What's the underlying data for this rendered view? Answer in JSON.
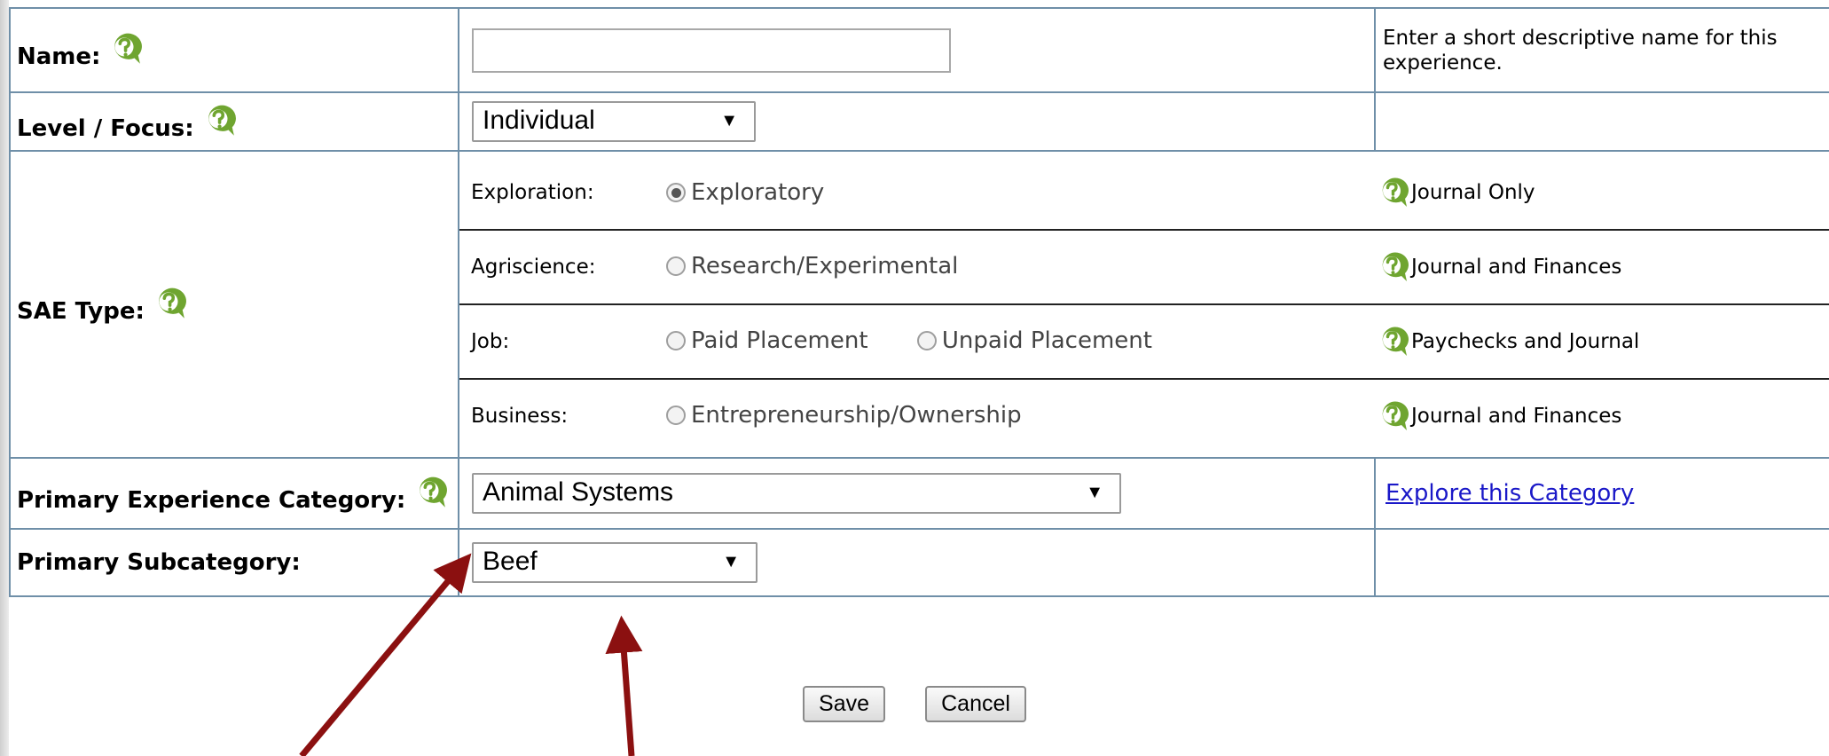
{
  "form": {
    "name_label": "Name:",
    "name_value": "",
    "name_hint": "Enter a short descriptive name for this experience.",
    "level_label": "Level / Focus:",
    "level_value": "Individual",
    "sae_label": "SAE Type:",
    "sae_rows": [
      {
        "category": "Exploration:",
        "options": [
          {
            "label": "Exploratory",
            "selected": true
          }
        ],
        "tracking": "Journal Only"
      },
      {
        "category": "Agriscience:",
        "options": [
          {
            "label": "Research/Experimental",
            "selected": false
          }
        ],
        "tracking": "Journal and Finances"
      },
      {
        "category": "Job:",
        "options": [
          {
            "label": "Paid Placement",
            "selected": false
          },
          {
            "label": "Unpaid Placement",
            "selected": false
          }
        ],
        "tracking": "Paychecks and Journal"
      },
      {
        "category": "Business:",
        "options": [
          {
            "label": "Entrepreneurship/Ownership",
            "selected": false
          }
        ],
        "tracking": "Journal and Finances"
      }
    ],
    "primary_category_label": "Primary Experience Category:",
    "primary_category_value": "Animal Systems",
    "explore_link": "Explore this Category",
    "subcategory_label": "Primary Subcategory:",
    "subcategory_value": "Beef"
  },
  "buttons": {
    "save": "Save",
    "cancel": "Cancel"
  },
  "icons": {
    "help": "help-question-icon",
    "dropdown": "dropdown-arrow-icon"
  },
  "colors": {
    "help_green": "#6fa530",
    "border": "#6f8fa8",
    "link": "#1a18c8",
    "arrow": "#8b1010"
  }
}
